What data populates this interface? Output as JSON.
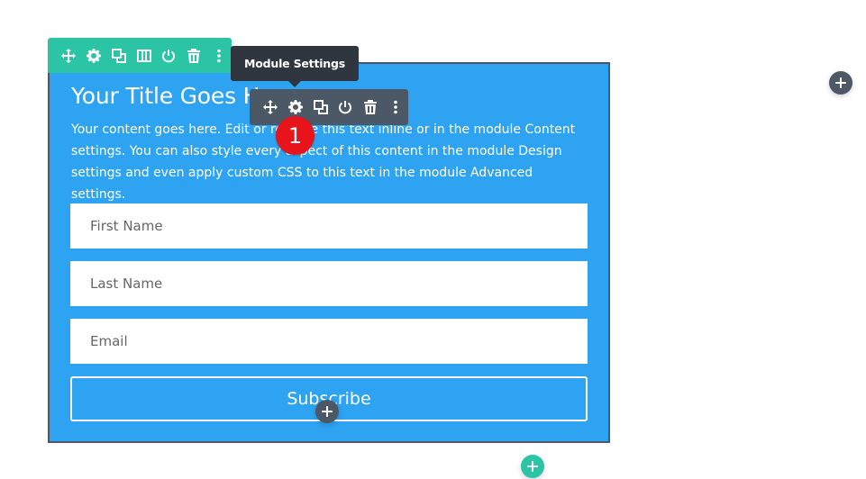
{
  "section_toolbar": {
    "icons": [
      "move-icon",
      "gear-icon",
      "duplicate-icon",
      "columns-icon",
      "save-icon",
      "trash-icon",
      "more-icon"
    ],
    "color": "#2bc5a6"
  },
  "module_toolbar": {
    "icons": [
      "move-icon",
      "gear-icon",
      "duplicate-icon",
      "save-icon",
      "trash-icon",
      "more-icon"
    ],
    "color": "#4c5866"
  },
  "tooltip": {
    "label": "Module Settings"
  },
  "step_badge": {
    "number": "1",
    "color": "#e8141c"
  },
  "module": {
    "title": "Your Title Goes Here",
    "body": "Your content goes here. Edit or remove this text inline or in the module Content settings. You can also style every aspect of this content in the module Design settings and even apply custom CSS to this text in the module Advanced settings.",
    "background": "#2ea3f2",
    "fields": {
      "first_name_placeholder": "First Name",
      "last_name_placeholder": "Last Name",
      "email_placeholder": "Email"
    },
    "subscribe_label": "Subscribe"
  },
  "add_buttons": {
    "row": "add-icon",
    "module": "add-icon",
    "section": "add-icon"
  }
}
